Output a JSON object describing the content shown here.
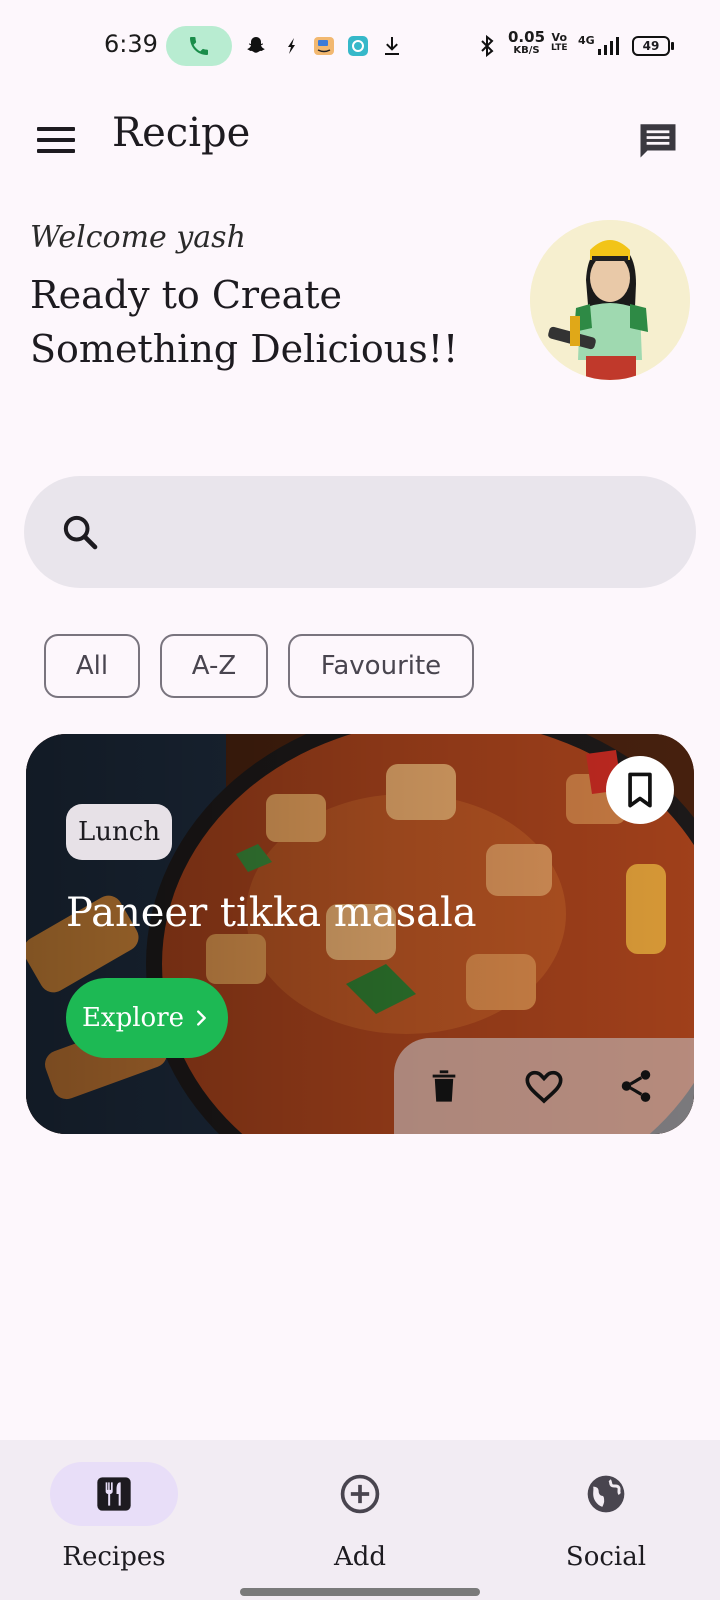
{
  "status_bar": {
    "time": "6:39",
    "net_speed": "0.05",
    "net_unit": "KB/S",
    "volte_top": "Vo",
    "volte_bottom": "LTE",
    "network": "4G",
    "battery": "49"
  },
  "appbar": {
    "title": "Recipe"
  },
  "greeting": {
    "welcome": "Welcome yash",
    "tagline": "Ready to Create Something Delicious!!"
  },
  "search": {
    "placeholder": ""
  },
  "filters": [
    {
      "label": "All"
    },
    {
      "label": "A-Z"
    },
    {
      "label": "Favourite"
    }
  ],
  "recipe_card": {
    "category": "Lunch",
    "name": "Paneer tikka masala",
    "explore_label": "Explore"
  },
  "bottom_nav": [
    {
      "label": "Recipes",
      "icon": "restaurant-icon",
      "active": true
    },
    {
      "label": "Add",
      "icon": "add-circle-icon",
      "active": false
    },
    {
      "label": "Social",
      "icon": "globe-icon",
      "active": false
    }
  ],
  "colors": {
    "background": "#fdf7fc",
    "accent_green": "#1db954",
    "active_pill": "#e8def8",
    "search_bg": "#e9e5ec"
  }
}
